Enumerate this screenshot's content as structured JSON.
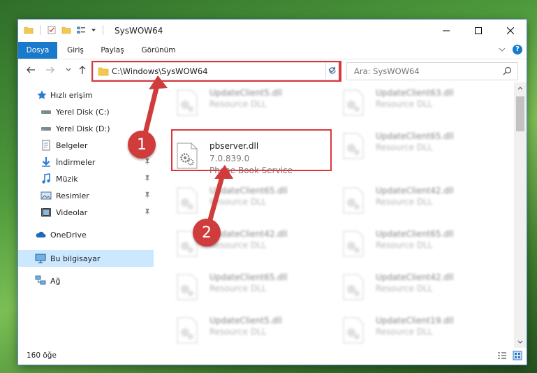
{
  "window": {
    "title": "SysWOW64"
  },
  "ribbon": {
    "tabs": [
      "Dosya",
      "Giriş",
      "Paylaş",
      "Görünüm"
    ]
  },
  "address": {
    "path": "C:\\Windows\\SysWOW64"
  },
  "search": {
    "placeholder": "Ara: SysWOW64"
  },
  "sidebar": {
    "items": [
      {
        "label": "Hızlı erişim",
        "icon": "star-icon"
      },
      {
        "label": "Yerel Disk (C:)",
        "icon": "drive-icon"
      },
      {
        "label": "Yerel Disk (D:)",
        "icon": "drive-icon"
      },
      {
        "label": "Belgeler",
        "icon": "documents-icon"
      },
      {
        "label": "İndirmeler",
        "icon": "download-icon"
      },
      {
        "label": "Müzik",
        "icon": "music-icon"
      },
      {
        "label": "Resimler",
        "icon": "pictures-icon"
      },
      {
        "label": "Videolar",
        "icon": "video-icon"
      },
      {
        "label": "OneDrive",
        "icon": "cloud-icon"
      },
      {
        "label": "Bu bilgisayar",
        "icon": "computer-icon"
      },
      {
        "label": "Ağ",
        "icon": "network-icon"
      }
    ]
  },
  "files": {
    "focused": {
      "name": "pbserver.dll",
      "version": "7.0.839.0",
      "description": "Phone Book Service"
    },
    "left": [
      {
        "name": "UpdateClient5.dll",
        "type": "Resource DLL"
      },
      {
        "name": "UpdateClient65.dll",
        "type": "Resource DLL"
      },
      {
        "name": "UpdateClient42.dll",
        "type": "Resource DLL"
      },
      {
        "name": "UpdateClient65.dll",
        "type": "Resource DLL"
      },
      {
        "name": "UpdateClient5.dll",
        "type": "Resource DLL"
      }
    ],
    "right": [
      {
        "name": "UpdateClient63.dll",
        "type": "Resource DLL"
      },
      {
        "name": "UpdateClient65.dll",
        "type": "Resource DLL"
      },
      {
        "name": "UpdateClient42.dll",
        "type": "Resource DLL"
      },
      {
        "name": "UpdateClient65.dll",
        "type": "Resource DLL"
      },
      {
        "name": "UpdateClient42.dll",
        "type": "Resource DLL"
      },
      {
        "name": "UpdateClient19.dll",
        "type": "Resource DLL"
      }
    ]
  },
  "status": {
    "count": "160 öğe"
  },
  "annotations": {
    "marker1": "1",
    "marker2": "2"
  },
  "colors": {
    "accent": "#1979ca",
    "highlight": "#d9383f",
    "selection": "#cce8ff"
  }
}
